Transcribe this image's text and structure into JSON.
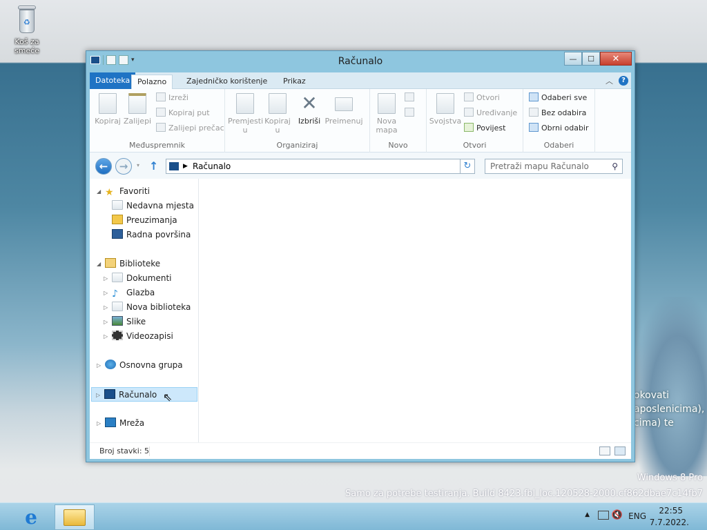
{
  "desktop": {
    "recycle_bin_label": "Koš za smeće",
    "background_text_lines": [
      "okovati",
      "aposlenicima),",
      "cima) te"
    ],
    "watermark": {
      "line1": "Windows 8 Pro",
      "line2": "Samo za potrebe testiranja. Build 8423.fbl_loc.120528-2000.cf862dbae7c14fb7"
    }
  },
  "window": {
    "title": "Računalo",
    "controls": {
      "minimize": "—",
      "maximize": "☐",
      "close": "✕"
    },
    "ribbon_tabs": [
      "Datoteka",
      "Polazno",
      "Zajedničko korištenje",
      "Prikaz"
    ],
    "active_tab": "Polazno",
    "ribbon": {
      "clipboard": {
        "label": "Međuspremnik",
        "copy": "Kopiraj",
        "paste": "Zalijepi",
        "cut": "Izreži",
        "copy_path": "Kopiraj put",
        "paste_shortcut": "Zalijepi prečac"
      },
      "organize": {
        "label": "Organiziraj",
        "move_to": "Premjesti",
        "move_to_2": "u",
        "copy_to": "Kopiraj",
        "copy_to_2": "u",
        "delete": "Izbriši",
        "rename": "Preimenuj"
      },
      "new": {
        "label": "Novo",
        "new_folder": "Nova",
        "new_folder_2": "mapa"
      },
      "open": {
        "label": "Otvori",
        "properties": "Svojstva",
        "open": "Otvori",
        "edit": "Uređivanje",
        "history": "Povijest"
      },
      "select": {
        "label": "Odaberi",
        "select_all": "Odaberi sve",
        "select_none": "Bez odabira",
        "invert": "Obrni odabir"
      }
    },
    "address": {
      "path": "Računalo"
    },
    "search": {
      "placeholder": "Pretraži mapu Računalo"
    },
    "nav": {
      "favorites": "Favoriti",
      "recent": "Nedavna mjesta",
      "downloads": "Preuzimanja",
      "desktop": "Radna površina",
      "libraries": "Biblioteke",
      "documents": "Dokumenti",
      "music": "Glazba",
      "new_library": "Nova biblioteka",
      "pictures": "Slike",
      "videos": "Videozapisi",
      "homegroup": "Osnovna grupa",
      "computer": "Računalo",
      "network": "Mreža"
    },
    "status": {
      "item_count": "Broj stavki: 5"
    }
  },
  "taskbar": {
    "language": "ENG",
    "time": "22:55",
    "date": "7.7.2022."
  },
  "icons": [
    "recycle-bin-icon",
    "back-icon",
    "forward-icon",
    "up-icon",
    "refresh-icon",
    "search-icon",
    "star-icon",
    "folder-icon",
    "computer-icon",
    "network-icon",
    "ie-icon"
  ]
}
